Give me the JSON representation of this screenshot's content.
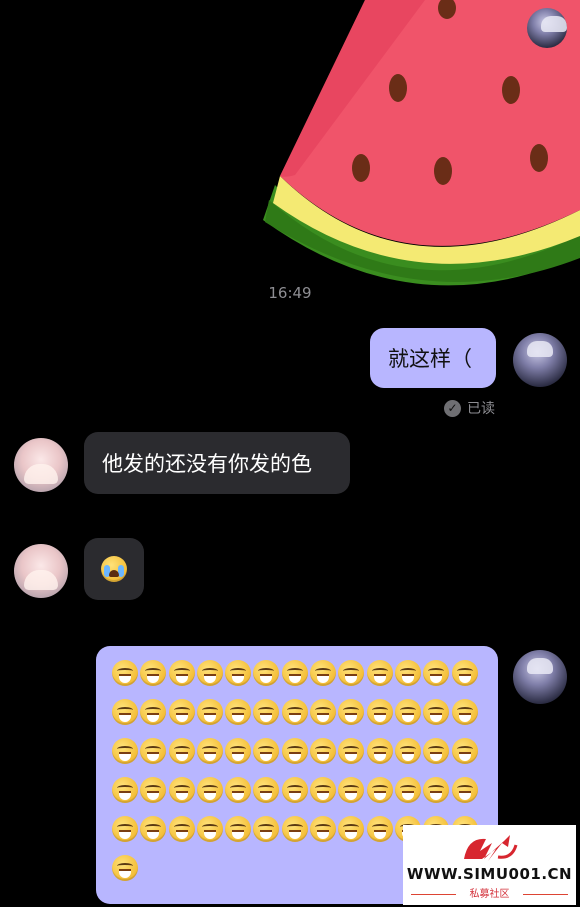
{
  "conversation": {
    "sticker": {
      "icon": "watermelon-sticker"
    },
    "timestamp": "16:49",
    "messages": [
      {
        "side": "right",
        "text": "就这样（"
      },
      {
        "side": "left",
        "text": "他发的还没有你发的色"
      },
      {
        "side": "left",
        "emoji": "crying-face-emoji",
        "count": 1
      },
      {
        "side": "right",
        "emoji": "laughing-face-emoji",
        "count": 66
      }
    ],
    "read_receipt": "已读"
  },
  "watermark": {
    "url": "WWW.SIMU001.CN",
    "subtitle": "私募社区"
  },
  "colors": {
    "background": "#000000",
    "bubble_out": "#b8b6ff",
    "bubble_in": "#2b2b2f",
    "timestamp": "#8e8e93"
  }
}
